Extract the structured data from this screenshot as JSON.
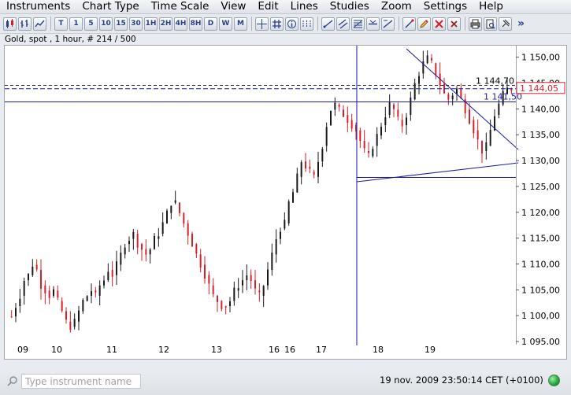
{
  "menu": [
    "Instruments",
    "Chart Type",
    "Time Scale",
    "View",
    "Edit",
    "Lines",
    "Studies",
    "Zoom",
    "Settings",
    "Help"
  ],
  "toolbar": {
    "timescale_buttons": [
      "T",
      "1",
      "5",
      "10",
      "15",
      "30",
      "1H",
      "2H",
      "4H",
      "8H",
      "D",
      "W",
      "M"
    ],
    "more_label": "»"
  },
  "chart": {
    "info": "Gold, spot , 1 hour, # 214 / 500",
    "price_ticks": [
      "1 150,00",
      "1 145,00",
      "1 140,00",
      "1 135,00",
      "1 130,00",
      "1 125,00",
      "1 120,00",
      "1 115,00",
      "1 110,00",
      "1 105,00",
      "1 100,00",
      "1 095,00"
    ],
    "date_ticks": [
      "09",
      "10",
      "11",
      "12",
      "13",
      "16",
      "16",
      "17",
      "18",
      "19"
    ],
    "current_price_tag": "1 144,05",
    "dashed_level_label": "1 144,70",
    "solid_level_label": "1 141,50",
    "colors": {
      "up": "#1a1a1a",
      "down": "#d8202a",
      "lines": "#1a1aa8",
      "tag": "#d8202a"
    }
  },
  "chart_data": {
    "type": "candlestick",
    "title": "Gold, spot , 1 hour, # 214 / 500",
    "ylim": [
      1095,
      1153
    ],
    "yticks": [
      1095,
      1100,
      1105,
      1110,
      1115,
      1120,
      1125,
      1130,
      1135,
      1140,
      1145,
      1150
    ],
    "x_labels": [
      "09",
      "10",
      "11",
      "12",
      "13",
      "16",
      "16",
      "17",
      "18",
      "19"
    ],
    "horizontal_levels": [
      1144.7,
      1144.05,
      1141.5,
      1126.9
    ],
    "current_price": 1144.05,
    "price_path": [
      1100,
      1102,
      1104,
      1107,
      1108,
      1110,
      1109,
      1106,
      1105,
      1104,
      1105,
      1103,
      1101,
      1099,
      1098,
      1099,
      1101,
      1103,
      1104,
      1105,
      1104,
      1106,
      1107,
      1109,
      1108,
      1110,
      1112,
      1114,
      1115,
      1116,
      1114,
      1113,
      1112,
      1113,
      1115,
      1116,
      1118,
      1120,
      1122,
      1122,
      1120,
      1118,
      1116,
      1114,
      1112,
      1110,
      1108,
      1106,
      1104,
      1103,
      1102,
      1102,
      1103,
      1105,
      1106,
      1107,
      1108,
      1107,
      1105,
      1104,
      1106,
      1109,
      1112,
      1115,
      1117,
      1118,
      1122,
      1124,
      1127,
      1130,
      1129,
      1128,
      1127,
      1130,
      1133,
      1137,
      1140,
      1141,
      1140,
      1139,
      1138,
      1137,
      1136,
      1134,
      1132,
      1131,
      1133,
      1135,
      1137,
      1139,
      1141,
      1140,
      1138,
      1137,
      1139,
      1142,
      1145,
      1147,
      1149,
      1150,
      1149,
      1147,
      1145,
      1143,
      1142,
      1143,
      1144,
      1142,
      1140,
      1138,
      1136,
      1134,
      1132,
      1133,
      1136,
      1139,
      1141,
      1143,
      1144,
      1144
    ]
  },
  "status": {
    "search_placeholder": "Type instrument name",
    "datetime": "19 nov. 2009 23:50:14  CET (+0100)"
  }
}
